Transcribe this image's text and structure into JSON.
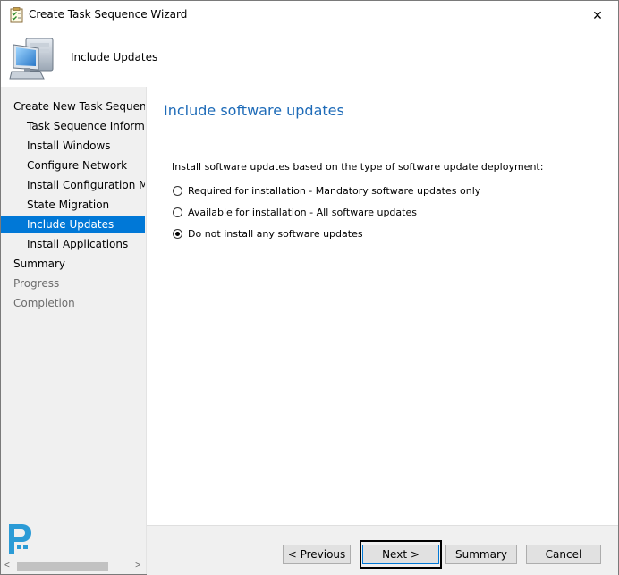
{
  "window": {
    "title": "Create Task Sequence Wizard",
    "close_glyph": "✕"
  },
  "header": {
    "title": "Include Updates",
    "icon": "computer-icon"
  },
  "sidebar": {
    "items": [
      {
        "label": "Create New Task Sequence",
        "level": 1,
        "state": "normal"
      },
      {
        "label": "Task Sequence Informati",
        "level": 2,
        "state": "normal"
      },
      {
        "label": "Install Windows",
        "level": 2,
        "state": "normal"
      },
      {
        "label": "Configure Network",
        "level": 2,
        "state": "normal"
      },
      {
        "label": "Install Configuration Mar",
        "level": 2,
        "state": "normal"
      },
      {
        "label": "State Migration",
        "level": 2,
        "state": "normal"
      },
      {
        "label": "Include Updates",
        "level": 2,
        "state": "selected"
      },
      {
        "label": "Install Applications",
        "level": 2,
        "state": "normal"
      },
      {
        "label": "Summary",
        "level": 1,
        "state": "normal"
      },
      {
        "label": "Progress",
        "level": 1,
        "state": "disabled"
      },
      {
        "label": "Completion",
        "level": 1,
        "state": "disabled"
      }
    ],
    "scroll_left_glyph": "<",
    "scroll_right_glyph": ">"
  },
  "main": {
    "heading": "Include software updates",
    "instruction": "Install software updates based on the type of software update deployment:",
    "options": [
      {
        "label": "Required for installation - Mandatory software updates only",
        "checked": false
      },
      {
        "label": "Available for installation - All software updates",
        "checked": false
      },
      {
        "label": "Do not install any software updates",
        "checked": true
      }
    ]
  },
  "footer": {
    "previous_label": "< Previous",
    "next_label": "Next >",
    "summary_label": "Summary",
    "cancel_label": "Cancel"
  },
  "colors": {
    "accent": "#0078d7",
    "heading": "#1e6bb8",
    "sidebar_bg": "#f0f0f0"
  }
}
